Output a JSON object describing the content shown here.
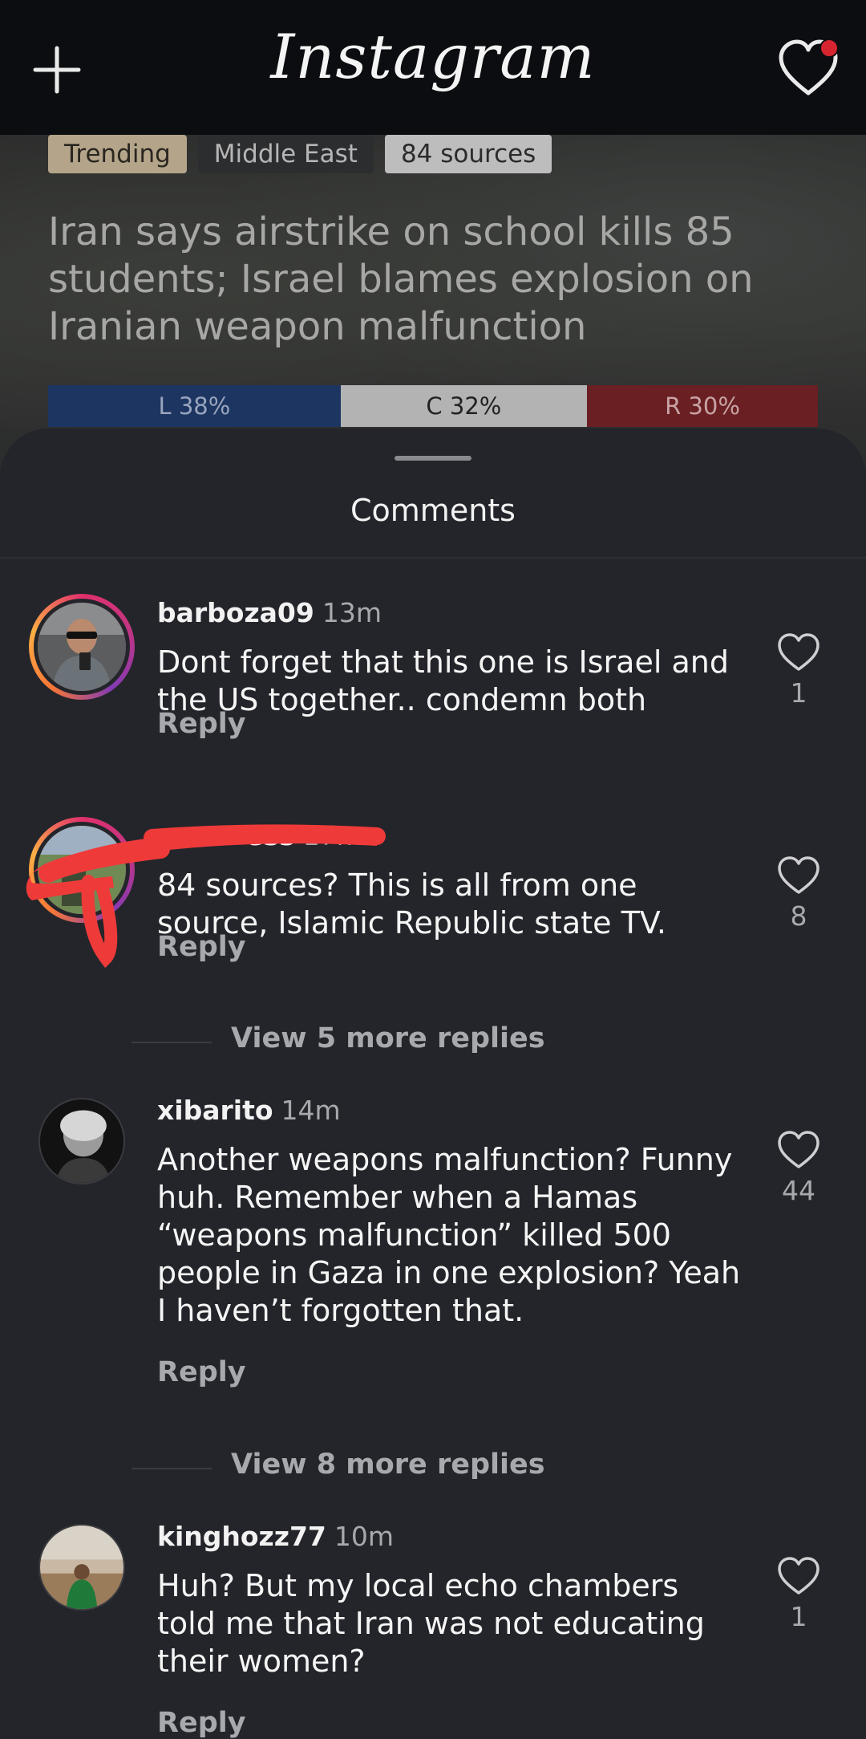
{
  "app": {
    "title": "Instagram",
    "has_notification": true,
    "accent": "#d62430"
  },
  "article": {
    "tags": {
      "trending": "Trending",
      "region": "Middle East",
      "sources": "84 sources"
    },
    "headline": "Iran says airstrike on school kills 85 students; Israel blames explosion on Iranian weapon malfunction",
    "bias": {
      "left_label": "L 38%",
      "center_label": "C 32%",
      "right_label": "R 30%",
      "left_pct": 38,
      "center_pct": 32,
      "right_pct": 30,
      "left_color": "#1c3561",
      "center_color": "#b3b3b3",
      "right_color": "#6a1f23"
    }
  },
  "comments_sheet": {
    "title": "Comments",
    "reply_label": "Reply",
    "comments": [
      {
        "username": "barboza09",
        "time": "13m",
        "text": "Dont forget that this one is Israel and the US together.. condemn both",
        "likes": "1"
      },
      {
        "username": "ess",
        "time": "17m",
        "text": "84 sources? This is all from one source, Islamic Republic state TV.",
        "likes": "8",
        "view_more": "View 5 more replies"
      },
      {
        "username": "xibarito",
        "time": "14m",
        "text": "Another weapons malfunction? Funny huh. Remember when a Hamas “weapons malfunction” killed 500 people in Gaza in one explosion? Yeah I haven’t forgotten that.",
        "likes": "44",
        "view_more": "View 8 more replies"
      },
      {
        "username": "kinghozz77",
        "time": "10m",
        "text": "Huh? But my local echo chambers told me that Iran was not educating their women?",
        "likes": "1"
      }
    ]
  }
}
